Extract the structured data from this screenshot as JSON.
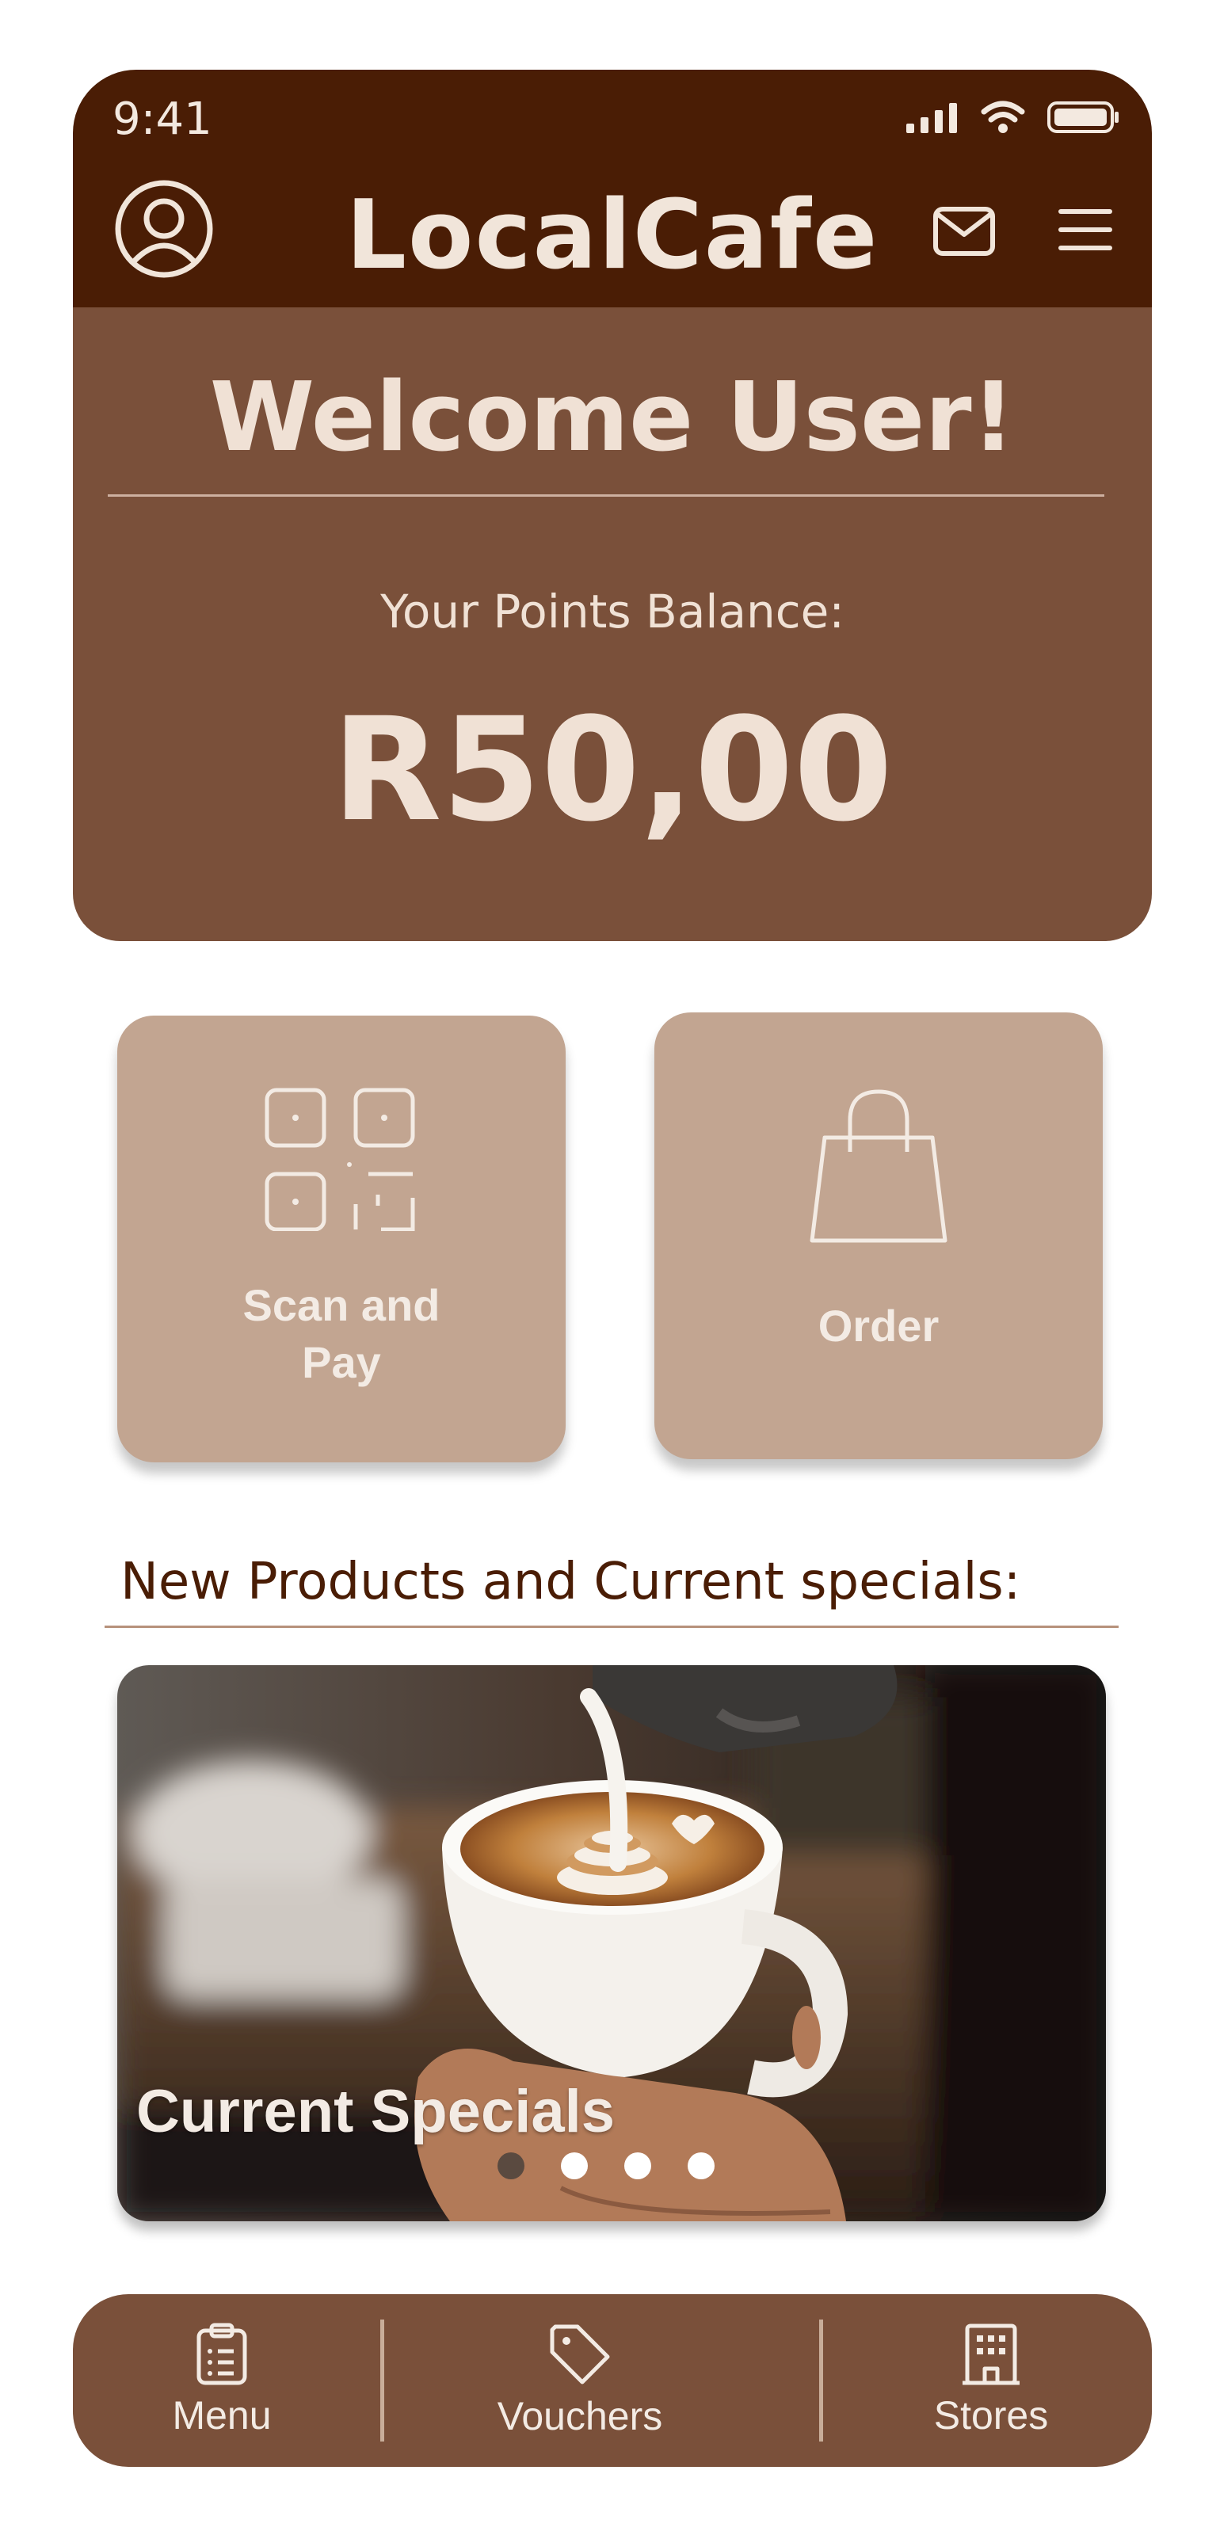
{
  "status_bar": {
    "time": "9:41"
  },
  "header": {
    "brand": "LocalCafe"
  },
  "welcome": {
    "title": "Welcome User!",
    "points_label": "Your Points Balance:",
    "points_value": "R50,00"
  },
  "actions": [
    {
      "label": "Scan and Pay",
      "icon": "qr-code-icon"
    },
    {
      "label": "Order",
      "icon": "shopping-bag-icon"
    }
  ],
  "specials": {
    "section_title": "New Products and Current specials:",
    "caption": "Current Specials",
    "carousel_total": 4,
    "carousel_active": 1
  },
  "bottom_nav": [
    {
      "label": "Menu",
      "icon": "clipboard-icon"
    },
    {
      "label": "Vouchers",
      "icon": "tag-icon"
    },
    {
      "label": "Stores",
      "icon": "building-icon"
    }
  ],
  "colors": {
    "header_bg": "#4a1d05",
    "card_bg": "#7a503a",
    "action_bg": "#c2a591",
    "text_light": "#f0e1d5"
  }
}
